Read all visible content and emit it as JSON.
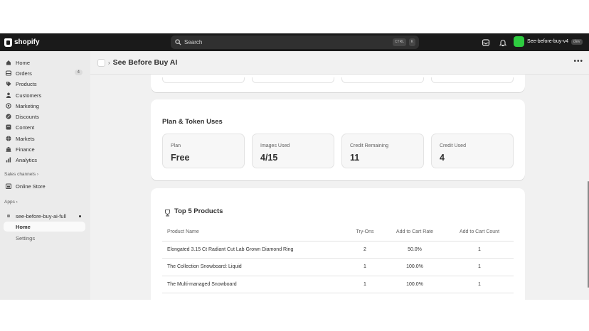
{
  "topbar": {
    "brand": "shopify",
    "search_label": "Search",
    "shortcut_ctrl": "CTRL",
    "shortcut_key": "K",
    "store_name": "See-before-buy-v4",
    "store_badge": "dev",
    "icons": [
      "shopify-logo-icon",
      "search-icon",
      "inbox-icon",
      "bell-icon"
    ]
  },
  "sidebar": {
    "items": [
      {
        "label": "Home",
        "icon": "home-icon"
      },
      {
        "label": "Orders",
        "icon": "orders-icon",
        "badge": "4"
      },
      {
        "label": "Products",
        "icon": "tag-icon"
      },
      {
        "label": "Customers",
        "icon": "person-icon"
      },
      {
        "label": "Marketing",
        "icon": "target-icon"
      },
      {
        "label": "Discounts",
        "icon": "discount-icon"
      },
      {
        "label": "Content",
        "icon": "content-icon"
      },
      {
        "label": "Markets",
        "icon": "globe-icon"
      },
      {
        "label": "Finance",
        "icon": "bank-icon"
      },
      {
        "label": "Analytics",
        "icon": "chart-icon"
      }
    ],
    "sales_channels_label": "Sales channels",
    "online_store_label": "Online Store",
    "apps_label": "Apps",
    "app_name": "see-before-buy-ai-full",
    "app_home": "Home",
    "app_settings": "Settings"
  },
  "page": {
    "title": "See Before Buy AI",
    "more_label": "•••"
  },
  "plan": {
    "title": "Plan & Token Uses",
    "stats": [
      {
        "label": "Plan",
        "value": "Free"
      },
      {
        "label": "Images Used",
        "value": "4/15"
      },
      {
        "label": "Credit Remaining",
        "value": "11"
      },
      {
        "label": "Credit Used",
        "value": "4"
      }
    ]
  },
  "products": {
    "title": "Top 5 Products",
    "columns": [
      "Product Name",
      "Try-Ons",
      "Add to Cart Rate",
      "Add to Cart Count"
    ],
    "rows": [
      {
        "name": "Elongated 3.15 Ct Radiant Cut Lab Grown Diamond Ring",
        "tryons": "2",
        "rate": "50.0%",
        "count": "1"
      },
      {
        "name": "The Collection Snowboard: Liquid",
        "tryons": "1",
        "rate": "100.0%",
        "count": "1"
      },
      {
        "name": "The Multi-managed Snowboard",
        "tryons": "1",
        "rate": "100.0%",
        "count": "1"
      }
    ]
  },
  "colors": {
    "topbar_bg": "#1a1a1a",
    "sidebar_bg": "#ebebeb",
    "main_bg": "#f1f1f1",
    "store_avatar": "#2ecc40"
  }
}
